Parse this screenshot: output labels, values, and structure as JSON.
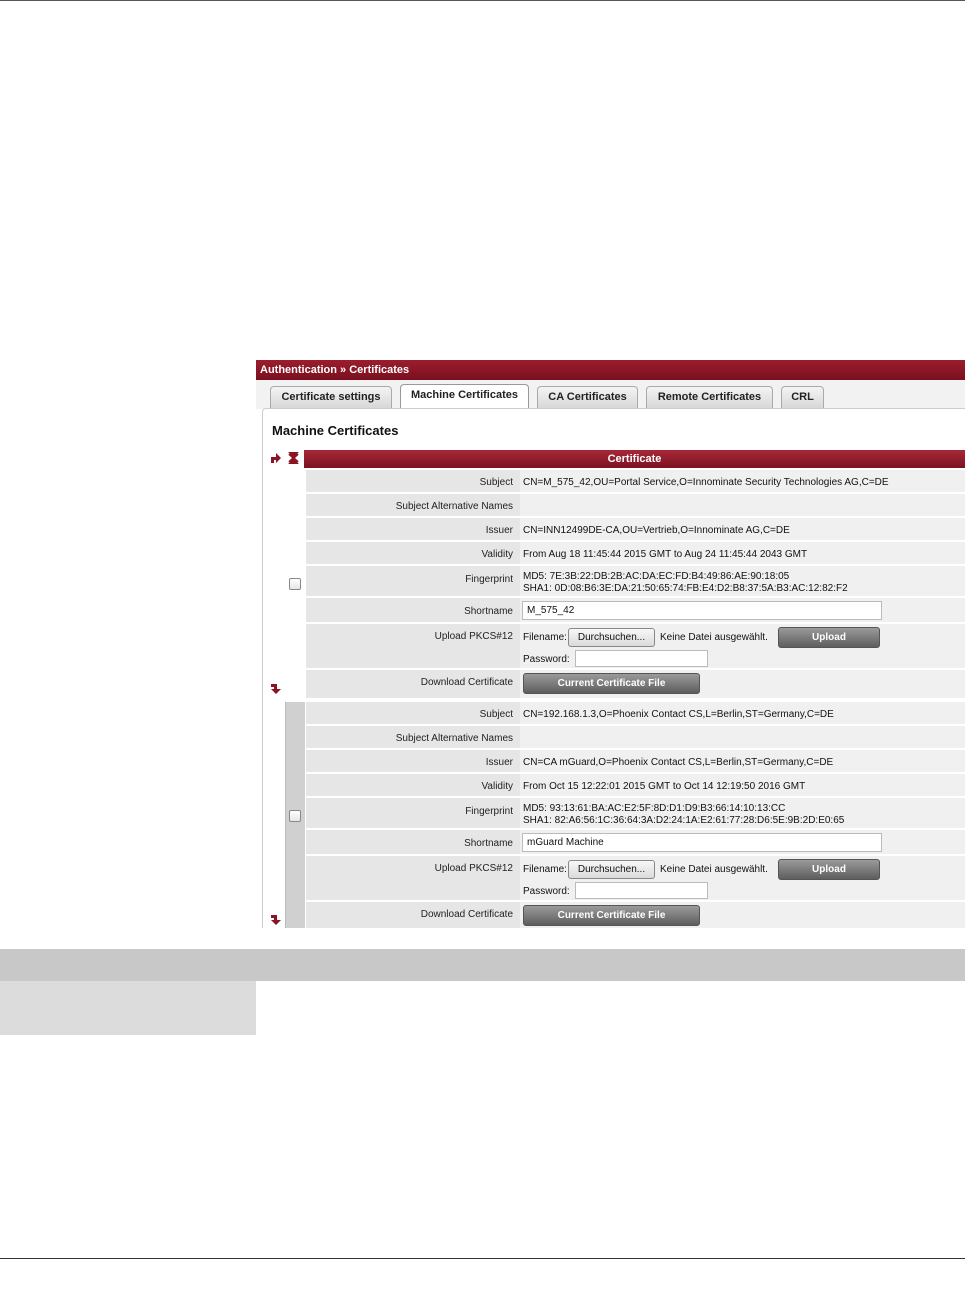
{
  "breadcrumb": "Authentication » Certificates",
  "tabs": [
    {
      "label": "Certificate settings",
      "active": false
    },
    {
      "label": "Machine Certificates",
      "active": true
    },
    {
      "label": "CA Certificates",
      "active": false
    },
    {
      "label": "Remote Certificates",
      "active": false
    },
    {
      "label": "CRL",
      "active": false
    }
  ],
  "page_title": "Machine Certificates",
  "table_header": "Certificate",
  "icons": {
    "insert_row": "insert-row-arrow-icon",
    "delete_row": "delete-row-icon",
    "insert_row_below": "insert-row-arrow-icon"
  },
  "labels": {
    "subject": "Subject",
    "san": "Subject Alternative Names",
    "issuer": "Issuer",
    "validity": "Validity",
    "fingerprint": "Fingerprint",
    "shortname": "Shortname",
    "upload": "Upload PKCS#12",
    "download": "Download Certificate",
    "filename": "Filename:",
    "browse": "Durchsuchen...",
    "no_file": "Keine Datei ausgewählt.",
    "upload_btn": "Upload",
    "password": "Password:",
    "current_file_btn": "Current Certificate File"
  },
  "certificates": [
    {
      "subject": "CN=M_575_42,OU=Portal Service,O=Innominate Security Technologies AG,C=DE",
      "san": "",
      "issuer": "CN=INN12499DE-CA,OU=Vertrieb,O=Innominate AG,C=DE",
      "validity": "From Aug 18 11:45:44 2015 GMT to Aug 24 11:45:44 2043 GMT",
      "md5": "MD5: 7E:3B:22:DB:2B:AC:DA:EC:FD:B4:49:86:AE:90:18:05",
      "sha1": "SHA1: 0D:08:B6:3E:DA:21:50:65:74:FB:E4:D2:B8:37:5A:B3:AC:12:82:F2",
      "shortname": "M_575_42",
      "password": "",
      "checked": false
    },
    {
      "subject": "CN=192.168.1.3,O=Phoenix Contact CS,L=Berlin,ST=Germany,C=DE",
      "san": "",
      "issuer": "CN=CA mGuard,O=Phoenix Contact CS,L=Berlin,ST=Germany,C=DE",
      "validity": "From Oct 15 12:22:01 2015 GMT to Oct 14 12:19:50 2016 GMT",
      "md5": "MD5: 93:13:61:BA:AC:E2:5F:8D:D1:D9:B3:66:14:10:13:CC",
      "sha1": "SHA1: 82:A6:56:1C:36:64:3A:D2:24:1A:E2:61:77:28:D6:5E:9B:2D:E0:65",
      "shortname": "mGuard Machine",
      "password": "",
      "checked": false
    }
  ]
}
